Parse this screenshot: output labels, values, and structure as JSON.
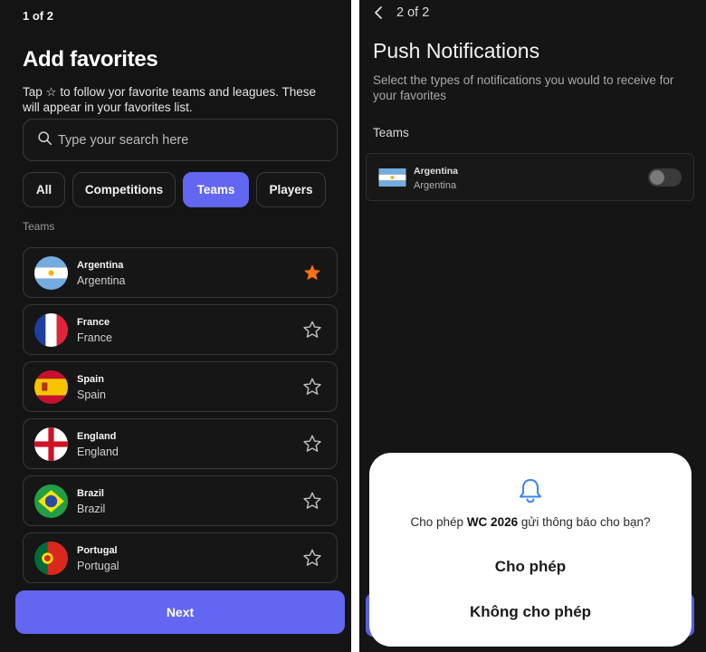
{
  "left_screen": {
    "step": "1 of 2",
    "title": "Add favorites",
    "subtitle": "Tap ☆ to follow yor favorite teams and leagues. These will appear in your favorites list.",
    "search": {
      "placeholder": "Type your search here",
      "icon": "search-icon"
    },
    "filter_chips": [
      {
        "label": "All",
        "active": false
      },
      {
        "label": "Competitions",
        "active": false
      },
      {
        "label": "Teams",
        "active": true
      },
      {
        "label": "Players",
        "active": false
      }
    ],
    "section_label": "Teams",
    "teams": [
      {
        "name": "Argentina",
        "sub": "Argentina",
        "flag_icon": "argentina-flag-icon",
        "favorited": true
      },
      {
        "name": "France",
        "sub": "France",
        "flag_icon": "france-flag-icon",
        "favorited": false
      },
      {
        "name": "Spain",
        "sub": "Spain",
        "flag_icon": "spain-flag-icon",
        "favorited": false
      },
      {
        "name": "England",
        "sub": "England",
        "flag_icon": "england-flag-icon",
        "favorited": false
      },
      {
        "name": "Brazil",
        "sub": "Brazil",
        "flag_icon": "brazil-flag-icon",
        "favorited": false
      },
      {
        "name": "Portugal",
        "sub": "Portugal",
        "flag_icon": "portugal-flag-icon",
        "favorited": false
      }
    ],
    "next_label": "Next",
    "colors": {
      "accent": "#6366f1",
      "star_active": "#f97316",
      "background": "#141414"
    }
  },
  "right_screen": {
    "step": "2 of 2",
    "title": "Push Notifications",
    "description": "Select the types of notifications you would to receive for your favorites",
    "section_label": "Teams",
    "team": {
      "name": "Argentina",
      "sub": "Argentina",
      "enabled": false
    },
    "dialog": {
      "icon": "bell-icon",
      "question_prefix": "Cho phép ",
      "app_name": "WC 2026",
      "question_suffix": " gửi thông báo cho bạn?",
      "allow_label": "Cho phép",
      "deny_label": "Không cho phép"
    }
  }
}
